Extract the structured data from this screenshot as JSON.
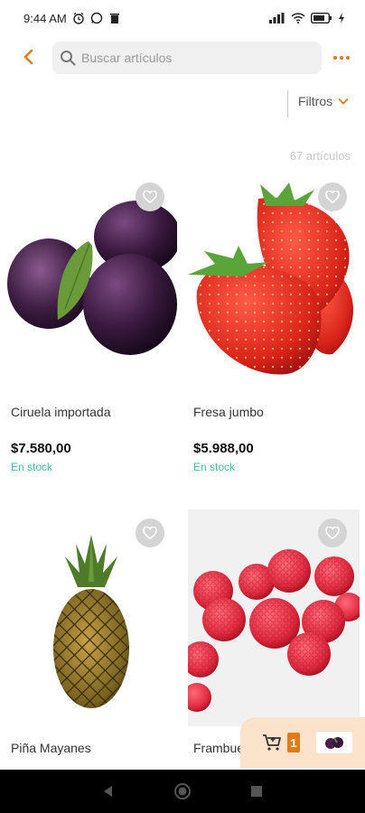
{
  "status_bar": {
    "time": "9:44 AM",
    "battery": "73"
  },
  "search": {
    "placeholder": "Buscar artículos"
  },
  "filters": {
    "label": "Filtros"
  },
  "result_count": "67 artículos",
  "products": [
    {
      "name": "Ciruela importada",
      "price": "$7.580,00",
      "stock": "En stock"
    },
    {
      "name": "Fresa jumbo",
      "price": "$5.988,00",
      "stock": "En stock"
    },
    {
      "name": "Piña Mayanes",
      "price": "",
      "stock": ""
    },
    {
      "name": "Frambuesa",
      "price": "",
      "stock": ""
    }
  ],
  "cart": {
    "count": "1"
  },
  "colors": {
    "accent": "#e07b1a",
    "stock": "#3bbf9f",
    "cart_bg": "#fbe3cb"
  },
  "icons": [
    "back-arrow-icon",
    "search-icon",
    "more-icon",
    "chevron-down-icon",
    "heart-icon",
    "cart-icon"
  ]
}
